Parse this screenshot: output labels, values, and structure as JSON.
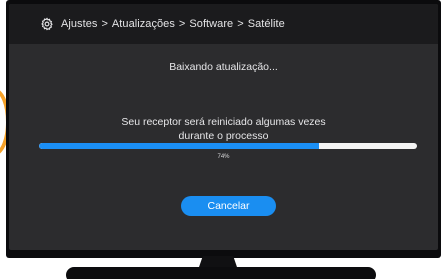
{
  "header": {
    "icon": "gear-icon",
    "breadcrumb": [
      "Ajustes",
      "Atualizações",
      "Software",
      "Satélite"
    ],
    "separator": ">"
  },
  "dialog": {
    "status": "Baixando atualização...",
    "message_line1": "Seu receptor será reiniciado algumas vezes",
    "message_line2": "durante o processo",
    "progress_percent": 74,
    "progress_label": "74%",
    "cancel_label": "Cancelar"
  },
  "colors": {
    "accent": "#1a8ef1",
    "progress_fill": "#1b8ff5",
    "progress_track": "#f4f4f4",
    "screen_bg": "#2c2c2e",
    "header_bg": "#1b1b1d",
    "ring": "#f5a128"
  }
}
